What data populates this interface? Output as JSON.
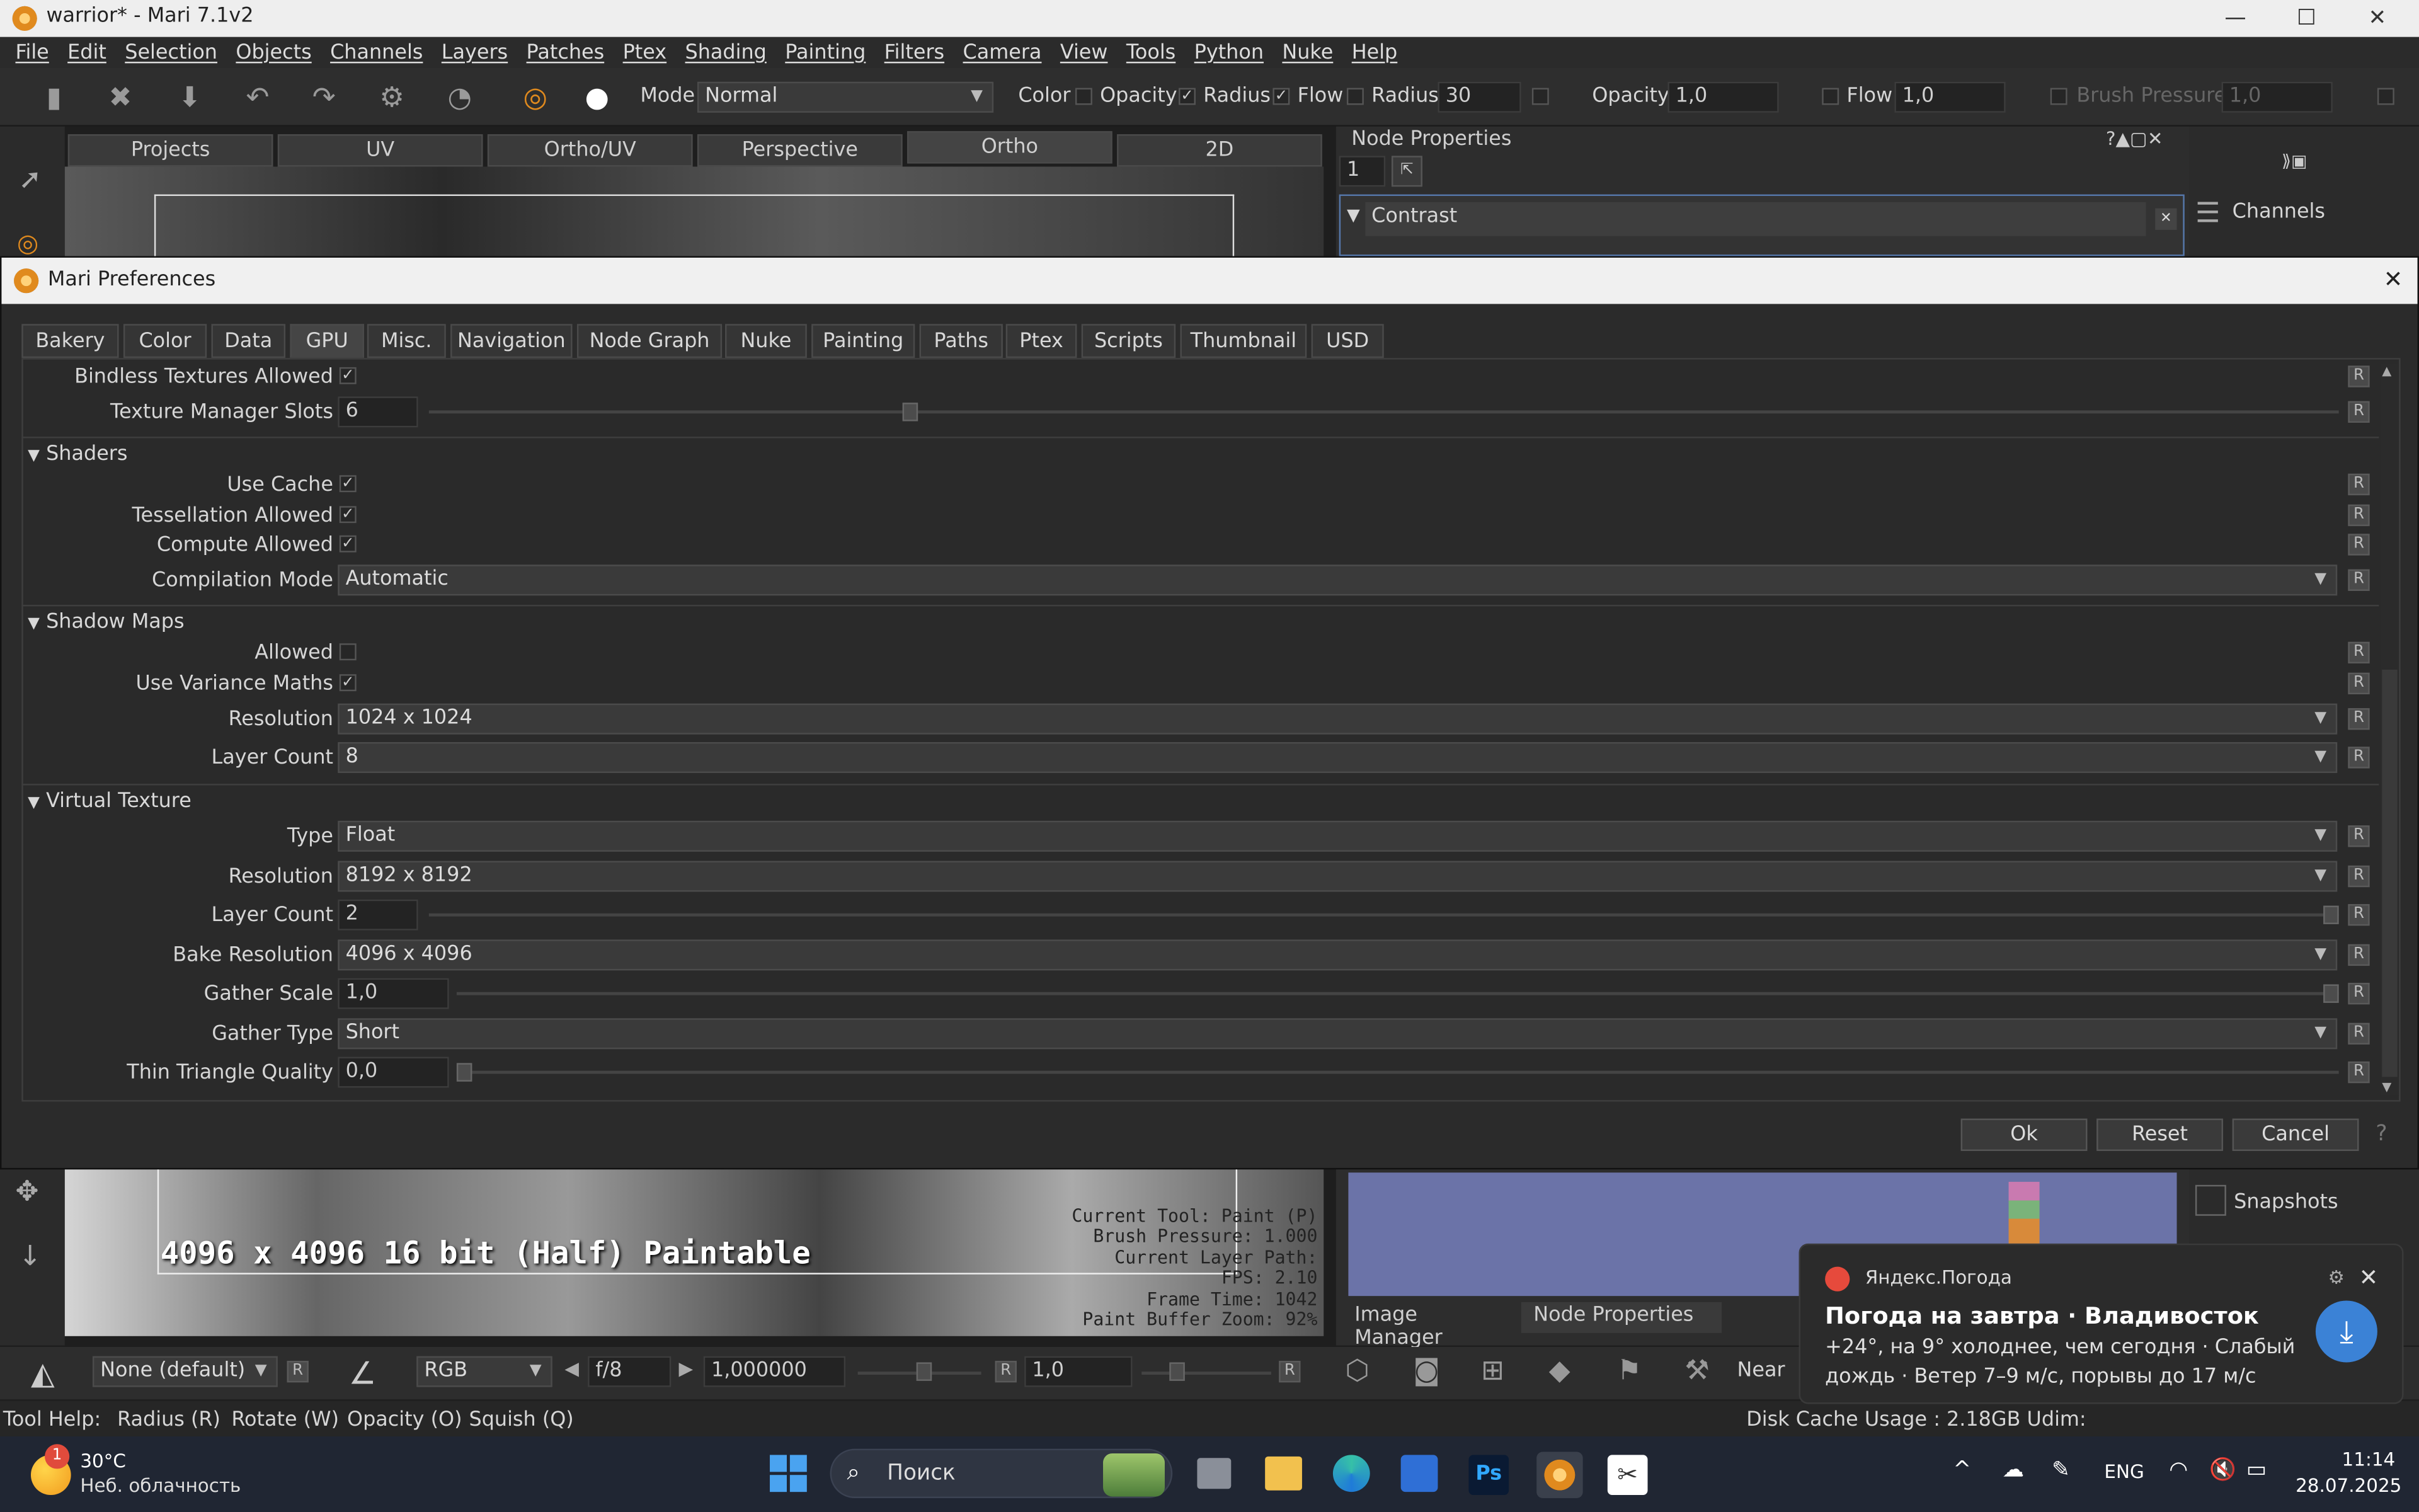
{
  "window": {
    "title": "warrior* - Mari 7.1v2",
    "min": "—",
    "max": "☐",
    "close": "✕"
  },
  "menu": [
    "File",
    "Edit",
    "Selection",
    "Objects",
    "Channels",
    "Layers",
    "Patches",
    "Ptex",
    "Shading",
    "Painting",
    "Filters",
    "Camera",
    "View",
    "Tools",
    "Python",
    "Nuke",
    "Help"
  ],
  "toolbar": {
    "mode_label": "Mode",
    "mode_value": "Normal",
    "color_label": "Color",
    "opacity_label": "Opacity",
    "radius_label": "Radius",
    "flow_label": "Flow",
    "radius2_label": "Radius",
    "radius_value": "30",
    "opacity2_label": "Opacity",
    "opacity_value": "1,0",
    "flow2_label": "Flow",
    "flow_value": "1,0",
    "brush_pressure_label": "Brush Pressure",
    "brush_pressure_value": "1,0"
  },
  "viewport_tabs": [
    "Projects",
    "UV",
    "Ortho/UV",
    "Perspective",
    "Ortho",
    "2D"
  ],
  "node_properties": {
    "title": "Node Properties",
    "field": "1",
    "node_name": "Contrast",
    "channels_label": "Channels"
  },
  "dialog": {
    "title": "Mari Preferences",
    "close": "✕",
    "tabs": [
      "Bakery",
      "Color",
      "Data",
      "GPU",
      "Misc.",
      "Navigation",
      "Node Graph",
      "Nuke",
      "Painting",
      "Paths",
      "Ptex",
      "Scripts",
      "Thumbnail",
      "USD"
    ],
    "active_tab": "GPU",
    "rows_top": {
      "bindless_label": "Bindless Textures Allowed",
      "tms_label": "Texture Manager Slots",
      "tms_value": "6",
      "tms_fraction": 0.25
    },
    "shaders": {
      "title": "Shaders",
      "use_cache": "Use Cache",
      "tessellation": "Tessellation Allowed",
      "compute": "Compute Allowed",
      "compilation_label": "Compilation Mode",
      "compilation_value": "Automatic"
    },
    "shadow": {
      "title": "Shadow Maps",
      "allowed": "Allowed",
      "variance": "Use Variance Maths",
      "resolution_label": "Resolution",
      "resolution_value": "1024 x 1024",
      "layer_count_label": "Layer Count",
      "layer_count_value": "8"
    },
    "vt": {
      "title": "Virtual Texture",
      "type_label": "Type",
      "type_value": "Float",
      "resolution_label": "Resolution",
      "resolution_value": "8192 x 8192",
      "layer_count_label": "Layer Count",
      "layer_count_value": "2",
      "bake_label": "Bake Resolution",
      "bake_value": "4096 x 4096",
      "gather_scale_label": "Gather Scale",
      "gather_scale_value": "1,0",
      "gather_type_label": "Gather Type",
      "gather_type_value": "Short",
      "thin_label": "Thin Triangle Quality",
      "thin_value": "0,0"
    },
    "r": "R",
    "ok": "Ok",
    "reset": "Reset",
    "cancel": "Cancel"
  },
  "viewport_overlay": {
    "big": "4096 x 4096 16 bit (Half) Paintable",
    "l1": "Current Tool: Paint (P)",
    "l2": "Brush Pressure: 1.000",
    "l3": "Current Layer Path:",
    "l4": "FPS: 2.10",
    "l5": "Frame Time: 1042",
    "l6": "Paint Buffer Zoom: 92%"
  },
  "right_panel": {
    "image_manager": "Image Manager",
    "node_properties": "Node Properties",
    "snapshots": "Snapshots"
  },
  "bottombar": {
    "lut": "None (default)",
    "r": "R",
    "channel": "RGB",
    "fstop": "f/8",
    "exposure": "1,000000",
    "gamma": "1,0",
    "near": "Near"
  },
  "status": {
    "help_label": "Tool Help:",
    "radius": "Radius (R)",
    "rotate": "Rotate (W)",
    "opacity": "Opacity (O)",
    "squish": "Squish (Q)",
    "cache": "Disk Cache Usage : 2.18GB Udim:"
  },
  "notification": {
    "app": "Яндекс.Погода",
    "title": "Погода на завтра · Владивосток",
    "body1": "+24°, на 9° холоднее, чем сегодня · Слабый",
    "body2": "дождь · Ветер 7–9 м/с, порывы до 17 м/с"
  },
  "taskbar": {
    "temp": "30°C",
    "weather": "Неб. облачность",
    "badge": "1",
    "search": "Поиск",
    "lang": "ENG",
    "time": "11:14",
    "date": "28.07.2025"
  }
}
